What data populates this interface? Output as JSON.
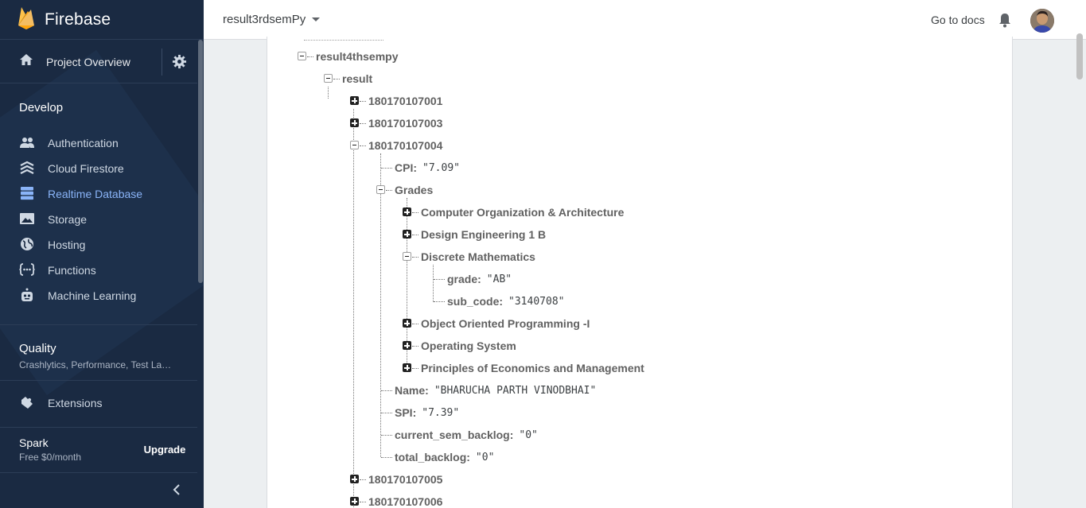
{
  "app": {
    "name": "Firebase"
  },
  "sidebar": {
    "overview_label": "Project Overview",
    "develop_title": "Develop",
    "develop_items": [
      {
        "label": "Authentication",
        "icon": "people-icon"
      },
      {
        "label": "Cloud Firestore",
        "icon": "firestore-icon"
      },
      {
        "label": "Realtime Database",
        "icon": "database-icon",
        "active": true
      },
      {
        "label": "Storage",
        "icon": "image-icon"
      },
      {
        "label": "Hosting",
        "icon": "globe-icon"
      },
      {
        "label": "Functions",
        "icon": "functions-icon"
      },
      {
        "label": "Machine Learning",
        "icon": "robot-icon"
      }
    ],
    "quality_title": "Quality",
    "quality_sub": "Crashlytics, Performance, Test La…",
    "extensions_label": "Extensions",
    "plan_name": "Spark",
    "plan_price": "Free $0/month",
    "upgrade_label": "Upgrade"
  },
  "topbar": {
    "project": "result3rdsemPy",
    "docs_label": "Go to docs"
  },
  "tree": {
    "root": "result4thsempy",
    "result": "result",
    "students_before": [
      "180170107001",
      "180170107003"
    ],
    "expanded_student": "180170107004",
    "cpi_key": "CPI",
    "cpi_val": "\"7.09\"",
    "grades_key": "Grades",
    "subjects_before": [
      "Computer Organization & Architecture",
      "Design Engineering 1 B"
    ],
    "expanded_subject": "Discrete Mathematics",
    "grade_key": "grade",
    "grade_val": "\"AB\"",
    "sub_code_key": "sub_code",
    "sub_code_val": "\"3140708\"",
    "subjects_after": [
      "Object Oriented Programming -I",
      "Operating System",
      "Principles of Economics and Management"
    ],
    "name_key": "Name",
    "name_val": "\"BHARUCHA PARTH VINODBHAI\"",
    "spi_key": "SPI",
    "spi_val": "\"7.39\"",
    "csb_key": "current_sem_backlog",
    "csb_val": "\"0\"",
    "tb_key": "total_backlog",
    "tb_val": "\"0\"",
    "students_after": [
      "180170107005",
      "180170107006"
    ]
  },
  "colors": {
    "sidebar_bg": "#1a2a42",
    "active": "#8ab4f8",
    "accent": "#ffa000"
  }
}
